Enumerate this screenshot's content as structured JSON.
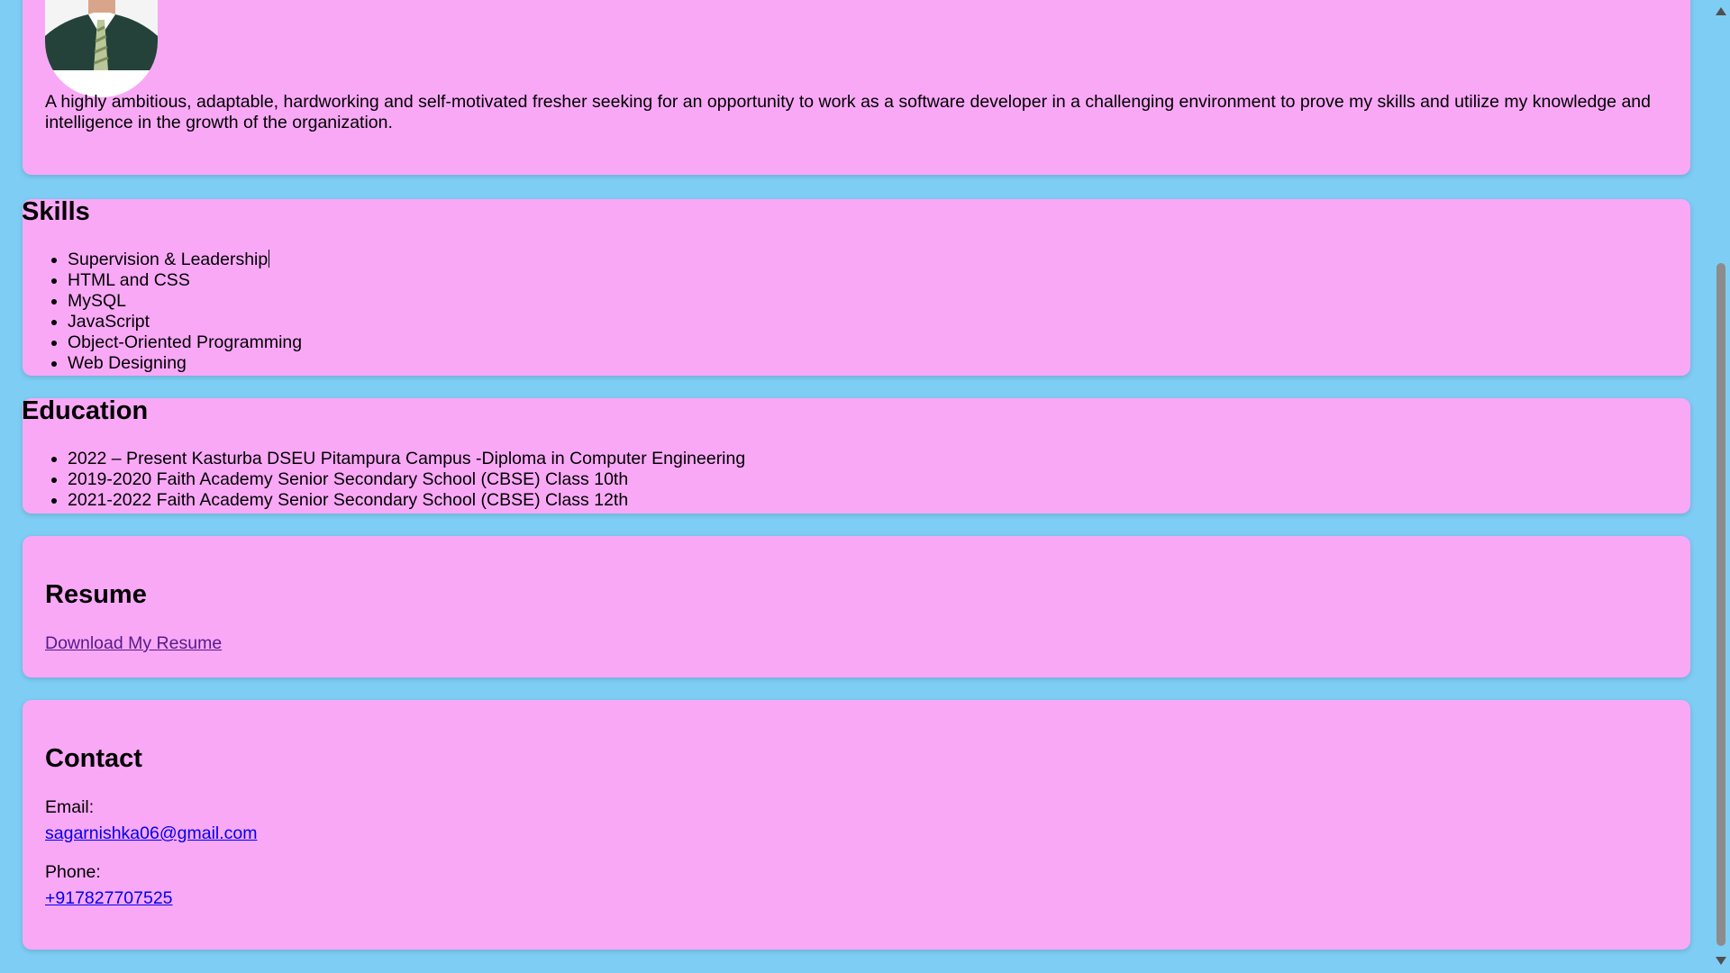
{
  "about": {
    "avatar_alt": "profile photo",
    "summary": "A highly ambitious, adaptable, hardworking and self-motivated fresher seeking for an opportunity to work as a software developer in a challenging environment to prove my skills and utilize my knowledge and intelligence in the growth of the organization."
  },
  "skills": {
    "title": "Skills",
    "items": [
      "Supervision & Leadership",
      "HTML and CSS",
      "MySQL",
      "JavaScript",
      "Object-Oriented Programming",
      "Web Designing"
    ]
  },
  "education": {
    "title": "Education",
    "items": [
      "2022 – Present Kasturba DSEU Pitampura Campus -Diploma in Computer Engineering",
      "2019-2020 Faith Academy Senior Secondary School (CBSE) Class 10th",
      "2021-2022 Faith Academy Senior Secondary School (CBSE) Class 12th"
    ]
  },
  "resume": {
    "title": "Resume",
    "link_text": "Download My Resume"
  },
  "contact": {
    "title": "Contact",
    "email_label": "Email:",
    "email": "sagarnishka06@gmail.com",
    "phone_label": "Phone:",
    "phone": "+917827707525"
  },
  "colors": {
    "page_background": "#7ecdf5",
    "card_background": "#f9a8f6",
    "link": "#0000ee",
    "visited_link": "#551a8b"
  },
  "icons": {
    "scroll_up": "triangle-up-icon",
    "scroll_down": "triangle-down-icon"
  }
}
